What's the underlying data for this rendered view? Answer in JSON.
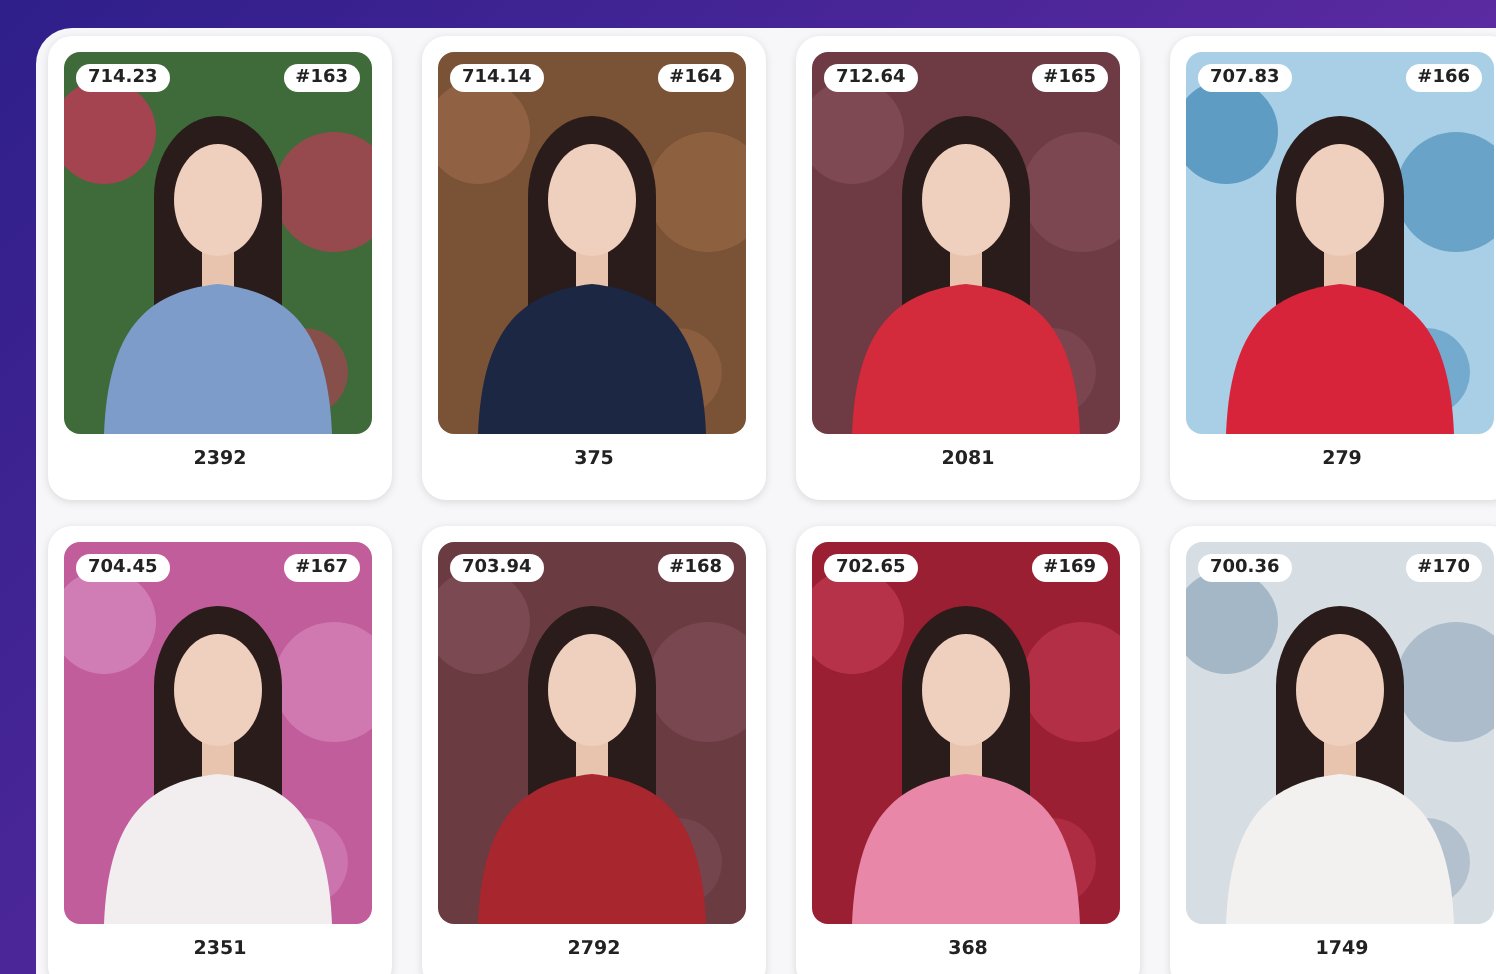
{
  "cards": [
    {
      "score": "714.23",
      "number": "#163",
      "count": "2392"
    },
    {
      "score": "714.14",
      "number": "#164",
      "count": "375"
    },
    {
      "score": "712.64",
      "number": "#165",
      "count": "2081"
    },
    {
      "score": "707.83",
      "number": "#166",
      "count": "279"
    },
    {
      "score": "704.45",
      "number": "#167",
      "count": "2351"
    },
    {
      "score": "703.94",
      "number": "#168",
      "count": "2792"
    },
    {
      "score": "702.65",
      "number": "#169",
      "count": "368"
    },
    {
      "score": "700.36",
      "number": "#170",
      "count": "1749"
    }
  ]
}
